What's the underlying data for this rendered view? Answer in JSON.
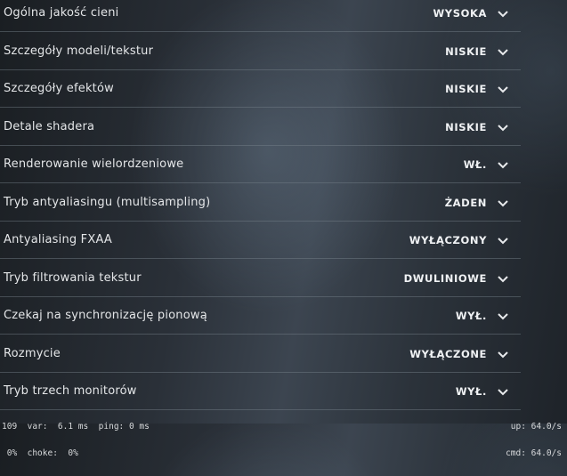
{
  "settings": [
    {
      "label": "Ogólna jakość cieni",
      "value": "WYSOKA"
    },
    {
      "label": "Szczegóły modeli/tekstur",
      "value": "NISKIE"
    },
    {
      "label": "Szczegóły efektów",
      "value": "NISKIE"
    },
    {
      "label": "Detale shadera",
      "value": "NISKIE"
    },
    {
      "label": "Renderowanie wielordzeniowe",
      "value": "WŁ."
    },
    {
      "label": "Tryb antyaliasingu (multisampling)",
      "value": "ŻADEN"
    },
    {
      "label": "Antyaliasing FXAA",
      "value": "WYŁĄCZONY"
    },
    {
      "label": "Tryb filtrowania tekstur",
      "value": "DWULINIOWE"
    },
    {
      "label": "Czekaj na synchronizację pionową",
      "value": "WYŁ."
    },
    {
      "label": "Rozmycie",
      "value": "WYŁĄCZONE"
    },
    {
      "label": "Tryb trzech monitorów",
      "value": "WYŁ."
    }
  ],
  "icons": {
    "dropdown": "chevron-down-icon"
  },
  "netgraph": {
    "line1_left": "109  var:  6.1 ms  ping: 0 ms",
    "line2_left": " 0%  choke:  0%",
    "line1_right": "up: 64.0/s",
    "line2_right": "cmd: 64.0/s"
  },
  "colors": {
    "text": "#e4e6e8",
    "divider": "#78828c"
  }
}
